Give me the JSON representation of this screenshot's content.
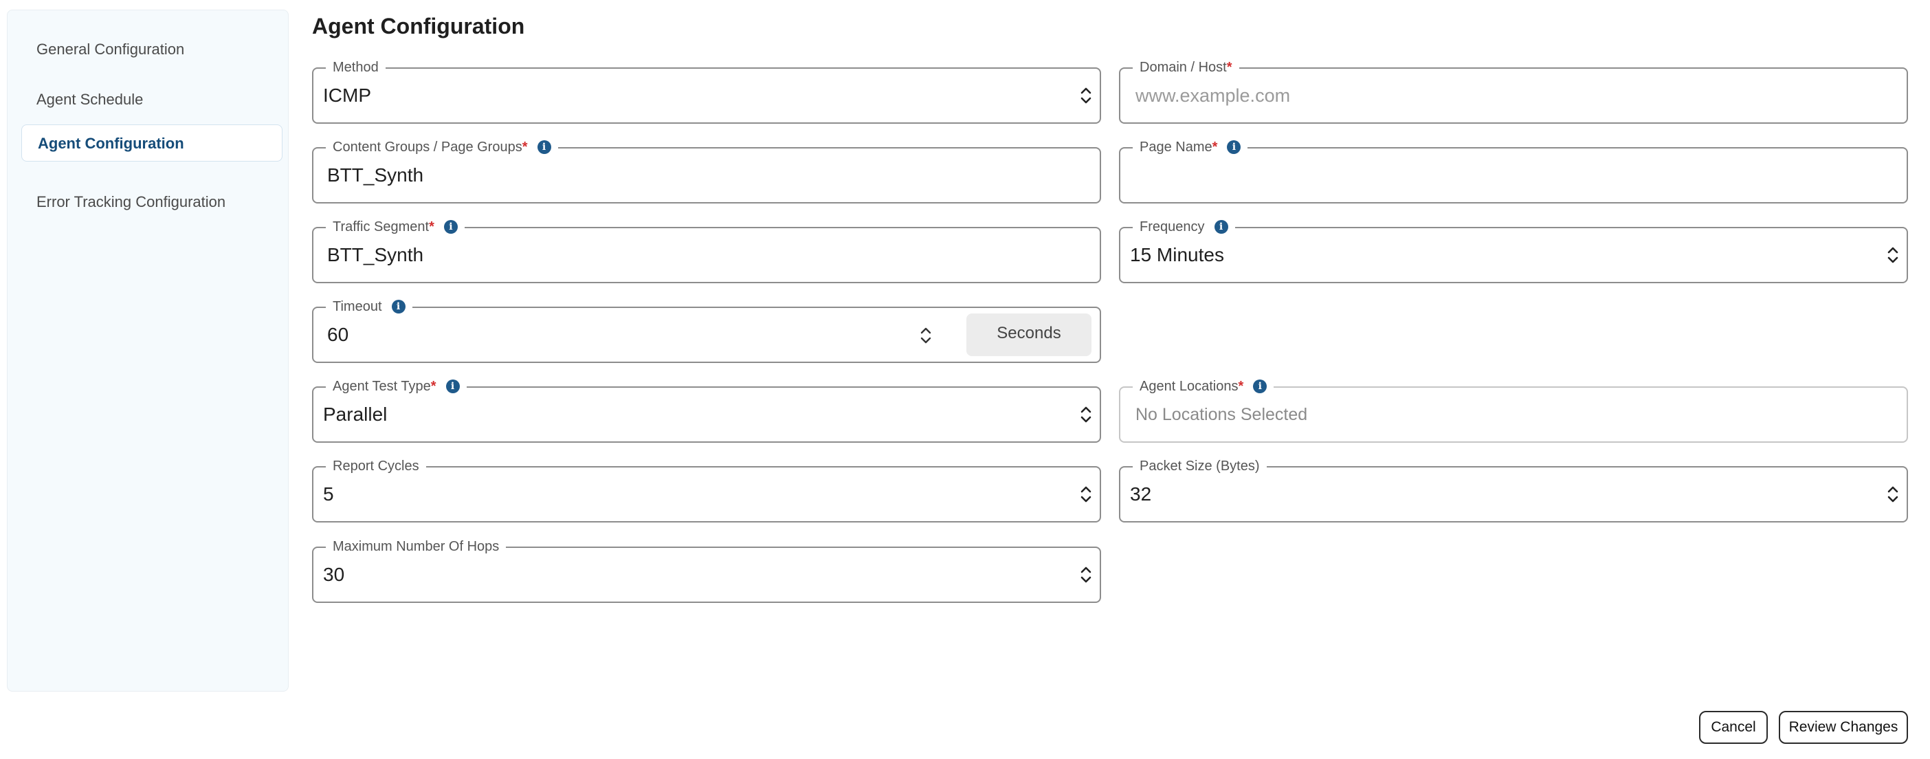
{
  "sidebar": {
    "items": [
      {
        "label": "General Configuration"
      },
      {
        "label": "Agent Schedule"
      },
      {
        "label": "Agent Configuration"
      },
      {
        "label": "Error Tracking Configuration"
      }
    ]
  },
  "page": {
    "title": "Agent Configuration"
  },
  "form": {
    "method": {
      "label": "Method",
      "value": "ICMP"
    },
    "domain": {
      "label": "Domain / Host",
      "placeholder": "www.example.com"
    },
    "content_groups": {
      "label": "Content Groups / Page Groups",
      "value": "BTT_Synth"
    },
    "page_name": {
      "label": "Page Name",
      "value": ""
    },
    "traffic_segment": {
      "label": "Traffic Segment",
      "value": "BTT_Synth"
    },
    "frequency": {
      "label": "Frequency",
      "value": "15 Minutes"
    },
    "timeout": {
      "label": "Timeout",
      "value": "60",
      "unit": "Seconds"
    },
    "agent_test_type": {
      "label": "Agent Test Type",
      "value": "Parallel"
    },
    "agent_locations": {
      "label": "Agent Locations",
      "placeholder": "No Locations Selected"
    },
    "report_cycles": {
      "label": "Report Cycles",
      "value": "5"
    },
    "packet_size": {
      "label": "Packet Size (Bytes)",
      "value": "32"
    },
    "max_hops": {
      "label": "Maximum Number Of Hops",
      "value": "30"
    },
    "required_mark": "*",
    "info_glyph": "i"
  },
  "footer": {
    "cancel_label": "Cancel",
    "review_label": "Review Changes"
  },
  "colors": {
    "accent": "#154c79",
    "required": "#d32f2f",
    "info": "#1f5a8b"
  }
}
